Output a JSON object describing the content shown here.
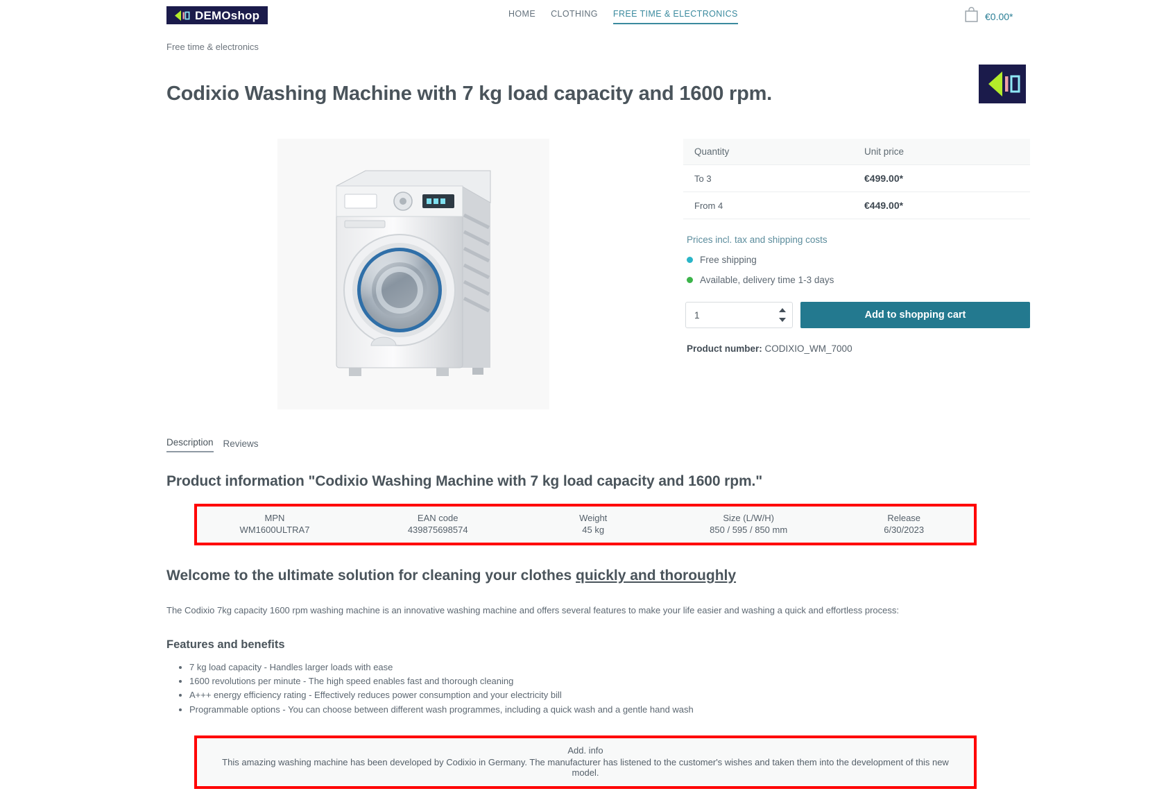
{
  "header": {
    "logo_text": "DEMOshop",
    "logo_icon": "chevron-left-logo-icon",
    "nav": [
      {
        "label": "HOME",
        "active": false
      },
      {
        "label": "CLOTHING",
        "active": false
      },
      {
        "label": "FREE TIME & ELECTRONICS",
        "active": true
      }
    ],
    "cart": {
      "icon": "shopping-bag-icon",
      "price": "€0.00*"
    }
  },
  "breadcrumb": "Free time & electronics",
  "product": {
    "title": "Codixio Washing Machine with 7 kg load capacity and 1600 rpm.",
    "manufacturer_logo_icon": "codixio-brand-logo-icon",
    "image_alt": "washing-machine-image",
    "number_label": "Product number:",
    "number_value": "CODIXIO_WM_7000"
  },
  "price_table": {
    "headers": [
      "Quantity",
      "Unit price"
    ],
    "rows": [
      {
        "quantity": "To 3",
        "unit_price": "€499.00*"
      },
      {
        "quantity": "From 4",
        "unit_price": "€449.00*"
      }
    ]
  },
  "buybox": {
    "tax_note": "Prices incl. tax and shipping costs",
    "shipping_status": "Free shipping",
    "shipping_dot_color": "#2ab5c8",
    "availability_status": "Available, delivery time 1-3 days",
    "availability_dot_color": "#3cb44a",
    "quantity_value": "1",
    "add_to_cart_label": "Add to shopping cart",
    "accent_color": "#23798f"
  },
  "tabs": [
    {
      "label": "Description",
      "active": true
    },
    {
      "label": "Reviews",
      "active": false
    }
  ],
  "description": {
    "heading": "Product information \"Codixio Washing Machine with 7 kg load capacity and 1600 rpm.\"",
    "spec_table": {
      "highlight_color": "#ff0000",
      "headers": [
        "MPN",
        "EAN code",
        "Weight",
        "Size (L/W/H)",
        "Release"
      ],
      "values": [
        "WM1600ULTRA7",
        "439875698574",
        "45 kg",
        "850 / 595 / 850 mm",
        "6/30/2023"
      ]
    },
    "lead_prefix": "Welcome to the ultimate solution for cleaning your clothes ",
    "lead_underlined": "quickly and thoroughly",
    "intro": "The Codixio 7kg capacity 1600 rpm washing machine is an innovative washing machine and offers several features to make your life easier and washing a quick and effortless process:",
    "features_heading": "Features and benefits",
    "features": [
      "7 kg load capacity - Handles larger loads with ease",
      "1600 revolutions per minute - The high speed enables fast and thorough cleaning",
      "A+++ energy efficiency rating - Effectively reduces power consumption and your electricity bill",
      "Programmable options - You can choose between different wash programmes, including a quick wash and a gentle hand wash"
    ],
    "add_info": {
      "highlight_color": "#ff0000",
      "header": "Add. info",
      "value": "This amazing washing machine has been developed by Codixio in Germany. The manufacturer has listened to the customer's wishes and taken them into the development of this new model."
    }
  }
}
